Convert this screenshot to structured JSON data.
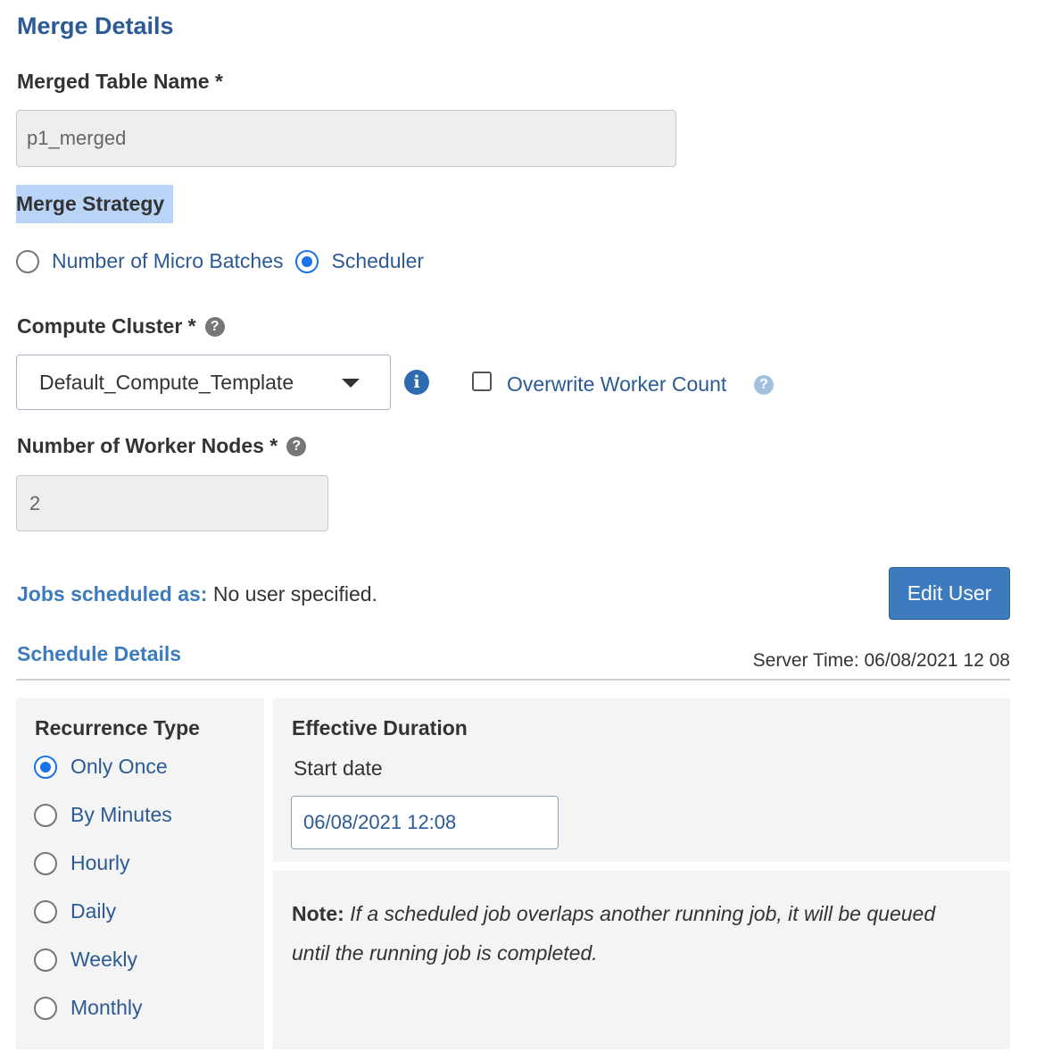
{
  "merge": {
    "title": "Merge Details",
    "table_name_label": "Merged Table Name *",
    "table_name_value": "p1_merged",
    "strategy_label": "Merge Strategy",
    "strategy_options": [
      "Number of Micro Batches",
      "Scheduler"
    ],
    "strategy_selected": "Scheduler"
  },
  "compute": {
    "cluster_label": "Compute Cluster *",
    "cluster_selected": "Default_Compute_Template",
    "overwrite_label": "Overwrite Worker Count",
    "overwrite_checked": false,
    "workers_label": "Number of Worker Nodes *",
    "workers_value": "2"
  },
  "jobs": {
    "scheduled_as_label": "Jobs scheduled as:",
    "scheduled_as_value": "No user specified.",
    "edit_user_label": "Edit User"
  },
  "schedule": {
    "title": "Schedule Details",
    "server_time": "Server Time: 06/08/2021 12 08",
    "recurrence_label": "Recurrence Type",
    "recurrence_options": [
      "Only Once",
      "By Minutes",
      "Hourly",
      "Daily",
      "Weekly",
      "Monthly"
    ],
    "recurrence_selected": "Only Once",
    "effective_duration_label": "Effective Duration",
    "start_date_label": "Start date",
    "start_date_value": "06/08/2021 12:08",
    "note_label": "Note:",
    "note_text": "If a scheduled job overlaps another running job, it will be queued",
    "note_text_2": "until the running job is completed."
  },
  "icons": [
    "help-icon",
    "info-icon",
    "chevron-down-icon"
  ],
  "colors": {
    "accent": "#2b5a94",
    "button": "#3c7bbd",
    "radio": "#1a73e8"
  }
}
